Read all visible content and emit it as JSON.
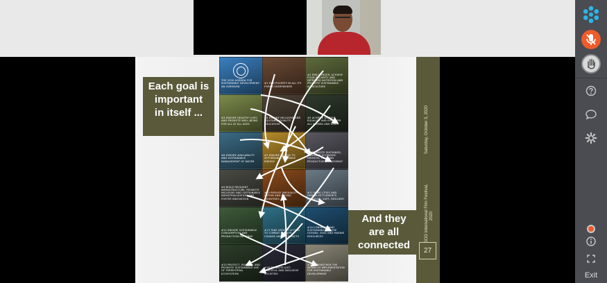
{
  "slide": {
    "callout_1": [
      "Each goal is",
      "important",
      "in itself ..."
    ],
    "callout_2": [
      "And they",
      "are all",
      "connected"
    ],
    "date_line": "Saturday, October 3, 2020",
    "festival_line_1": "SDG International Film Festival,",
    "festival_line_2": "2020",
    "page_number": "27",
    "tiles": [
      {
        "caption": "The 2030 Agenda for Sustainable Development: An Overview",
        "color": "#3a7fc0"
      },
      {
        "caption": "#1 End poverty in all its forms everywhere",
        "color": "#6b4a34"
      },
      {
        "caption": "#2 End hunger, achieve food security and improved nutrition and promote sustainable agriculture",
        "color": "#5d6a3c"
      },
      {
        "caption": "#3 Ensure healthy lives and promote well-being for all at all ages",
        "color": "#7b8a4a"
      },
      {
        "caption": "#4 Ensure inclusive and equitable quality education",
        "color": "#4e4336"
      },
      {
        "caption": "#5 Achieve gender equality and empower all women and girls",
        "color": "#2e3a2c"
      },
      {
        "caption": "#6 Ensure availability and sustainable management of water",
        "color": "#3b6a84"
      },
      {
        "caption": "#7 Ensure access to affordable, reliable energy",
        "color": "#b58a2a"
      },
      {
        "caption": "#8 Promote sustained, inclusive economic growth, full and productive employment",
        "color": "#585760"
      },
      {
        "caption": "#9 Build resilient infrastructure, promote inclusive and sustainable industrialization and foster innovation",
        "color": "#4a4a44"
      },
      {
        "caption": "#10 Reduce inequality within and among countries",
        "color": "#8a4a1c"
      },
      {
        "caption": "#11 Make cities and human settlements inclusive, safe, resilient",
        "color": "#6b7a86"
      },
      {
        "caption": "#12 Ensure sustainable consumption and production patterns",
        "color": "#3e5a3a"
      },
      {
        "caption": "#13 Take urgent action to combat climate change and its impacts",
        "color": "#2f6f86"
      },
      {
        "caption": "#14 Conserve and sustainably use the oceans, seas and marine resources",
        "color": "#1f4e70"
      },
      {
        "caption": "#15 Protect, restore and promote sustainable use of terrestrial ecosystems",
        "color": "#2d3d2a"
      },
      {
        "caption": "#16 Promote just, peaceful and inclusive societies",
        "color": "#2a2a38"
      },
      {
        "caption": "#17 Strengthen the means of implementation for sustainable development",
        "color": "#8c8878"
      }
    ]
  },
  "sidebar": {
    "exit_label": "Exit",
    "accent_color": "#ef5b2a"
  },
  "icons": [
    "app-logo-icon",
    "microphone-muted-icon",
    "raise-hand-icon",
    "help-icon",
    "chat-icon",
    "gear-icon",
    "info-icon",
    "fullscreen-icon"
  ]
}
